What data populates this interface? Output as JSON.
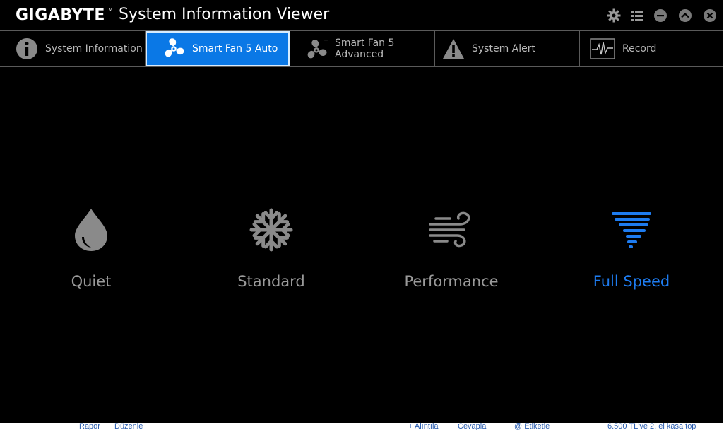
{
  "window": {
    "brand": "GIGABYTE",
    "brand_tm": "TM",
    "title": "System Information Viewer"
  },
  "window_controls": [
    "settings-icon",
    "list-icon",
    "minimize-icon",
    "collapse-icon",
    "close-icon"
  ],
  "tabs": [
    {
      "label": "System Information",
      "icon": "info-icon",
      "active": false
    },
    {
      "label": "Smart Fan 5 Auto",
      "icon": "fan-icon",
      "active": true
    },
    {
      "label": "Smart Fan 5 Advanced",
      "icon": "fan-plus-icon",
      "active": false
    },
    {
      "label": "System Alert",
      "icon": "warning-icon",
      "active": false
    },
    {
      "label": "Record",
      "icon": "pulse-icon",
      "active": false
    }
  ],
  "modes": [
    {
      "label": "Quiet",
      "icon": "water-drop-icon",
      "selected": false
    },
    {
      "label": "Standard",
      "icon": "snowflake-icon",
      "selected": false
    },
    {
      "label": "Performance",
      "icon": "wind-icon",
      "selected": false
    },
    {
      "label": "Full Speed",
      "icon": "tornado-icon",
      "selected": true
    }
  ],
  "colors": {
    "background": "#000000",
    "accent": "#0a78e6",
    "selected_text": "#1e7cf0",
    "inactive_text": "#9a9a9a"
  },
  "background_strip": {
    "items": [
      "Rapor",
      "Düzenle",
      "+ Alıntıla",
      "Cevapla",
      "@ Etiketle",
      "6.500 TL've 2. el kasa top"
    ]
  }
}
